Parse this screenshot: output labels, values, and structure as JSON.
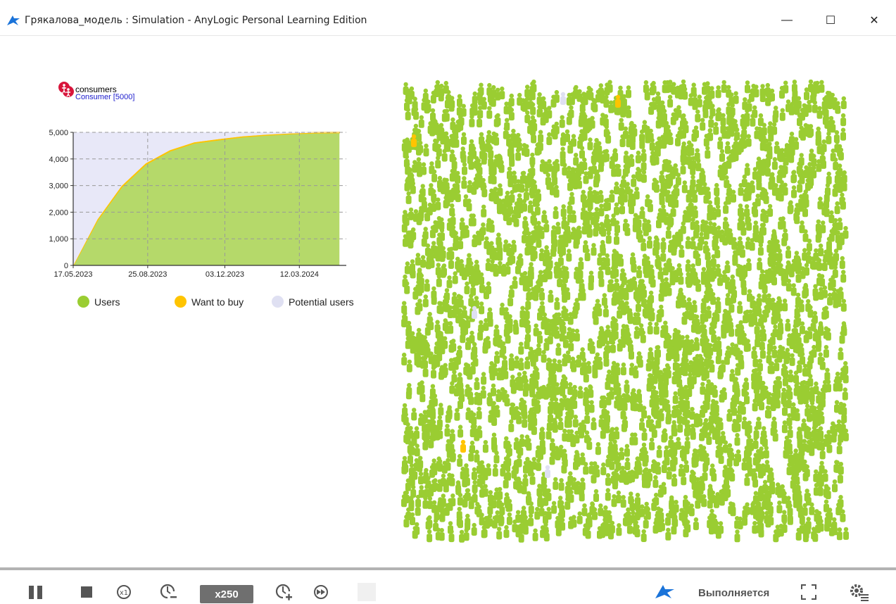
{
  "window": {
    "title": "Грякалова_модель : Simulation - AnyLogic Personal Learning Edition",
    "controls": {
      "minimize": "—",
      "maximize": "☐",
      "close": "✕"
    }
  },
  "population": {
    "name": "consumers",
    "count_label": "Consumer [5000]"
  },
  "chart_data": {
    "type": "area",
    "x": [
      "17.05.2023",
      "18.06.2023",
      "20.07.2023",
      "25.08.2023",
      "30.09.2023",
      "03.11.2023",
      "03.12.2023",
      "10.01.2024",
      "12.02.2024",
      "12.03.2024",
      "10.04.2024",
      "10.05.2024"
    ],
    "x_tick_labels": [
      "17.05.2023",
      "25.08.2023",
      "03.12.2023",
      "12.03.2024"
    ],
    "y_tick_labels": [
      "0",
      "1,000",
      "2,000",
      "3,000",
      "4,000",
      "5,000"
    ],
    "ylim": [
      0,
      5000
    ],
    "grid": true,
    "legend_position": "bottom",
    "series": [
      {
        "name": "Users",
        "color": "#b5d96a",
        "values": [
          0,
          1700,
          2950,
          3800,
          4300,
          4600,
          4720,
          4830,
          4900,
          4950,
          4980,
          4990
        ]
      },
      {
        "name": "Want to buy",
        "color": "#ffc400",
        "values": [
          0,
          30,
          40,
          40,
          35,
          30,
          30,
          25,
          20,
          15,
          10,
          5
        ]
      },
      {
        "name": "Potential users",
        "color": "#e8e8f8",
        "values": [
          5000,
          3270,
          2010,
          1160,
          665,
          370,
          250,
          145,
          80,
          35,
          10,
          5
        ]
      }
    ]
  },
  "legend": {
    "users": "Users",
    "want_to_buy": "Want to buy",
    "potential_users": "Potential users"
  },
  "colors": {
    "users": "#9acd32",
    "want_to_buy": "#ffc400",
    "potential_users": "#dfe0f2",
    "accent": "#1a73d9"
  },
  "toolbar": {
    "speed": "x250",
    "status": "Выполняется",
    "icons": [
      "pause-icon",
      "stop-icon",
      "realtime-icon",
      "slow-down-icon",
      "speed-up-icon",
      "fast-forward-icon",
      "step-icon",
      "anylogic-logo-icon",
      "fullscreen-icon",
      "settings-icon"
    ]
  }
}
